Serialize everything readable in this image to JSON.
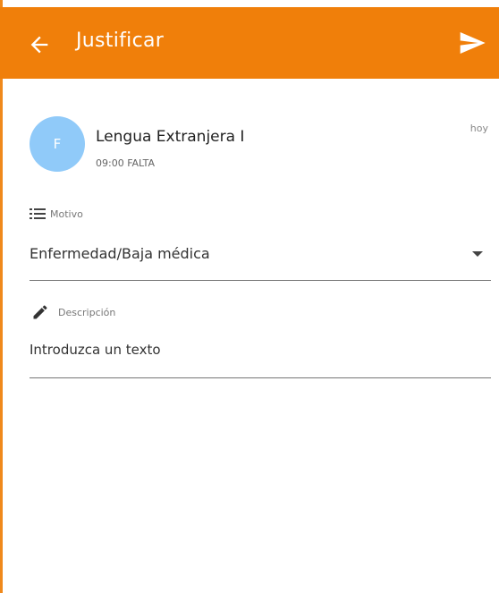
{
  "app_bar": {
    "title": "Justificar",
    "back_icon": "arrow-left-icon",
    "send_icon": "send-icon",
    "color": "#f07f0a"
  },
  "event": {
    "avatar_letter": "F",
    "avatar_color": "#90caf9",
    "subject": "Lengua Extranjera I",
    "detail": "09:00 FALTA",
    "date": "hoy"
  },
  "motivo": {
    "label": "Motivo",
    "icon": "list-icon",
    "selected_value": "Enfermedad/Baja médica"
  },
  "descripcion": {
    "label": "Descripción",
    "icon": "pencil-icon",
    "placeholder": "Introduzca un texto"
  }
}
